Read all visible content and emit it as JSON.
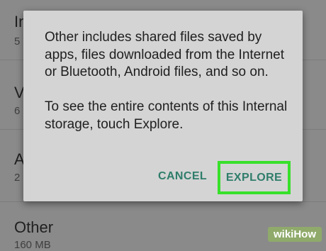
{
  "background_list": [
    {
      "title": "In",
      "subtitle": "5"
    },
    {
      "title": "V",
      "subtitle": "6"
    },
    {
      "title": "A",
      "subtitle": "2"
    },
    {
      "title": "Other",
      "subtitle": "160 MB"
    }
  ],
  "dialog": {
    "message_1": "Other includes shared files saved by apps, files downloaded from the Internet or Bluetooth, Android files, and so on.",
    "message_2": "To see the entire contents of this Internal storage, touch Explore.",
    "cancel_label": "CANCEL",
    "explore_label": "EXPLORE"
  },
  "watermark": "wikiHow",
  "colors": {
    "accent": "#2f7d6b",
    "highlight": "#38e02a",
    "dialog_bg": "#d4d4d4"
  }
}
